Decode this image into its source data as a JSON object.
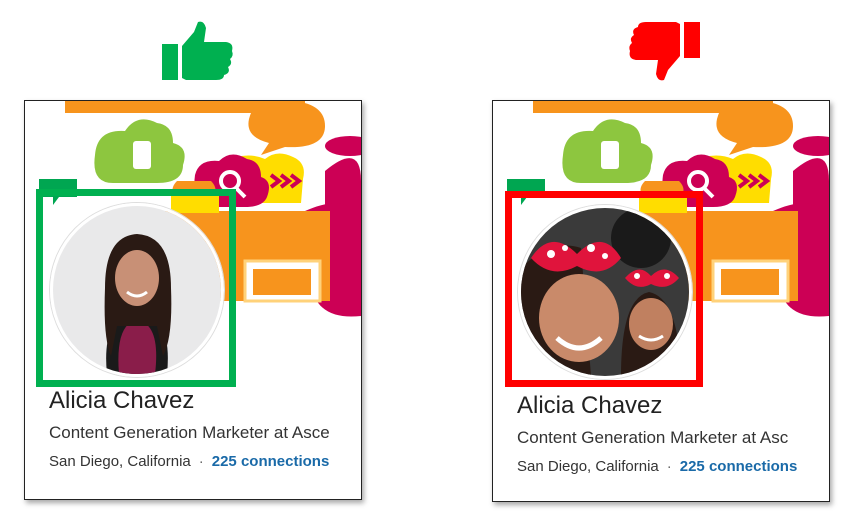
{
  "colors": {
    "approve": "#00b050",
    "reject": "#ff0000",
    "link": "#1a6aa8"
  },
  "icons": {
    "approve": "thumbs-up-icon",
    "reject": "thumbs-down-icon"
  },
  "cards": [
    {
      "verdict": "good",
      "name": "Alicia Chavez",
      "headline": "Content Generation Marketer at Asce",
      "location": "San Diego, California",
      "separator": "·",
      "connections": "225 connections"
    },
    {
      "verdict": "bad",
      "name": "Alicia Chavez",
      "headline": "Content Generation Marketer at Asc",
      "location": "San Diego, California",
      "separator": "·",
      "connections": "225 connections"
    }
  ]
}
